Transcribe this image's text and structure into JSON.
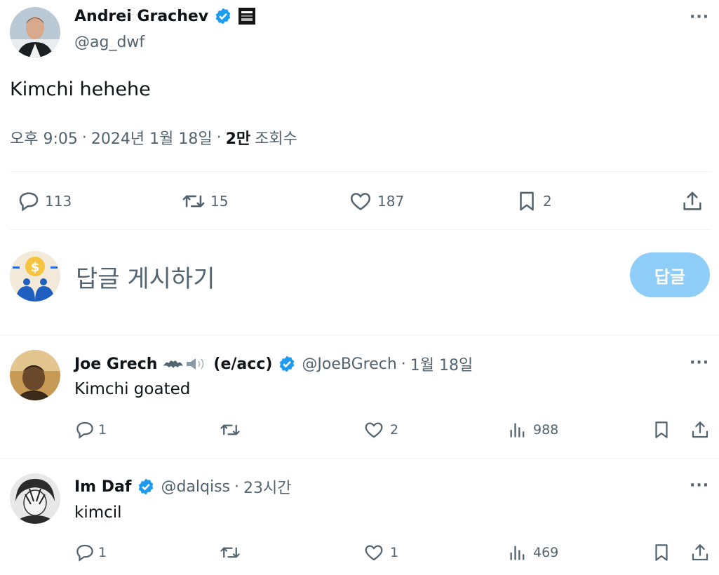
{
  "tweet": {
    "author_name": "Andrei Grachev",
    "author_handle": "@ag_dwf",
    "text": "Kimchi hehehe",
    "time": "오후 9:05",
    "date": "2024년 1월 18일",
    "views_count": "2만",
    "views_label": "조회수",
    "sep": "·",
    "metrics": {
      "replies": "113",
      "retweets": "15",
      "likes": "187",
      "bookmarks": "2"
    }
  },
  "compose": {
    "placeholder": "답글 게시하기",
    "reply_button": "답글"
  },
  "replies": [
    {
      "name": "Joe Grech",
      "name_suffix": "(e/acc)",
      "handle": "@JoeBGrech",
      "time": "1월 18일",
      "text": "Kimchi goated",
      "replies": "1",
      "likes": "2",
      "views": "988"
    },
    {
      "name": "Im Daf",
      "handle": "@dalqiss",
      "time": "23시간",
      "text": "kimcil",
      "replies": "1",
      "likes": "1",
      "views": "469"
    }
  ],
  "more_label": "···",
  "colors": {
    "verified": "#1d9bf0",
    "reply_button": "#8ecdf7",
    "muted": "#536471"
  }
}
